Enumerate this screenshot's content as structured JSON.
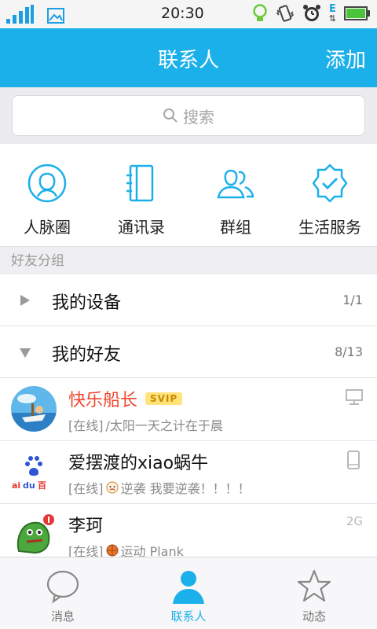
{
  "status_bar": {
    "time": "20:30",
    "network": "E"
  },
  "header": {
    "title": "联系人",
    "add_label": "添加"
  },
  "search": {
    "placeholder": "搜索"
  },
  "quick_entries": [
    {
      "label": "人脉圈",
      "icon": "person-circle-icon"
    },
    {
      "label": "通讯录",
      "icon": "address-book-icon"
    },
    {
      "label": "群组",
      "icon": "group-icon"
    },
    {
      "label": "生活服务",
      "icon": "service-badge-icon"
    }
  ],
  "section_title": "好友分组",
  "groups": [
    {
      "name": "我的设备",
      "count": "1/1",
      "expanded": false
    },
    {
      "name": "我的好友",
      "count": "8/13",
      "expanded": true
    }
  ],
  "contacts": [
    {
      "name": "快乐船长",
      "badge": "SVIP",
      "status": "[在线]",
      "signature": "/太阳一天之计在于晨",
      "device": "desktop-icon"
    },
    {
      "name": "爱摆渡的xiao蜗牛",
      "status": "[在线]",
      "signature": "逆袭 我要逆袭！！！！",
      "device": "phone-icon"
    },
    {
      "name": "李珂",
      "status": "[在线]",
      "signature": "运动 Plank",
      "network": "2G"
    }
  ],
  "tabs": [
    {
      "label": "消息",
      "icon": "message-bubble-icon",
      "active": false
    },
    {
      "label": "联系人",
      "icon": "contacts-person-icon",
      "active": true
    },
    {
      "label": "动态",
      "icon": "star-icon",
      "active": false
    }
  ],
  "colors": {
    "accent": "#1cb0ea",
    "vip_name": "#f0452c"
  }
}
